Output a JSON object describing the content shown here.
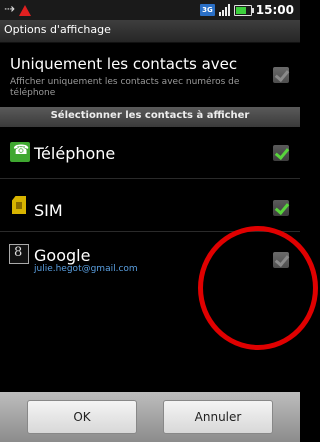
{
  "status_bar": {
    "clock": "15:00",
    "network_badge": "3G",
    "icons": [
      "usb-icon",
      "warning-icon",
      "3g-icon",
      "signal-icon",
      "battery-icon"
    ],
    "battery_level": 0.75
  },
  "dialog": {
    "title": "Options d'affichage",
    "option": {
      "title": "Uniquement les contacts avec",
      "subtitle": "Afficher uniquement les contacts avec numéros de téléphone",
      "checked": false
    },
    "section_header": "Sélectionner les contacts à afficher",
    "accounts": [
      {
        "label": "Téléphone",
        "icon": "phone-icon",
        "checked": true
      },
      {
        "label": "SIM",
        "icon": "sim-icon",
        "checked": true
      },
      {
        "label": "Google",
        "subtitle": "julie.hegot@gmail.com",
        "icon": "google-icon",
        "checked": false
      }
    ],
    "buttons": {
      "ok": "OK",
      "cancel": "Annuler"
    }
  },
  "colors": {
    "check_on": "#58d43c",
    "annotation": "#e00000",
    "link_blue": "#5a9fe0"
  }
}
